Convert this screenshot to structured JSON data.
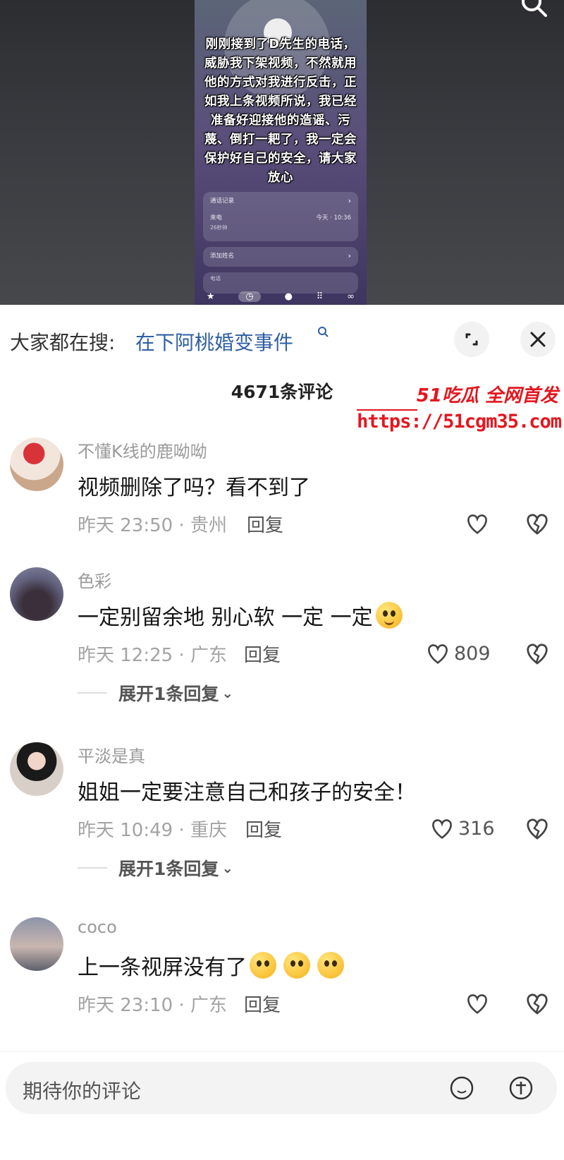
{
  "video": {
    "caption": "刚刚接到了D先生的电话，威胁我下架视频，不然就用他的方式对我进行反击，正如我上条视频所说，我已经准备好迎接他的造谣、污蔑、倒打一耙了，我一定会保护好自己的安全，请大家放心",
    "call_records_label": "通话记录",
    "incoming_label": "来电",
    "duration": "26秒钟",
    "call_time": "今天 · 10:36",
    "add_name_label": "添加姓名",
    "phone_label": "电话"
  },
  "trend": {
    "label": "大家都在搜:",
    "link": "在下阿桃婚变事件"
  },
  "comments_count": "4671条评论",
  "watermark": {
    "brand": "51吃瓜 全网首发",
    "url": "https://51cgm35.com"
  },
  "comments": [
    {
      "user": "不懂K线的鹿呦呦",
      "text": "视频删除了吗？看不到了",
      "time_loc": "昨天 23:50 · 贵州",
      "reply": "回复",
      "likes": ""
    },
    {
      "user": "色彩",
      "text": "一定别留余地 别心软 一定 一定",
      "time_loc": "昨天 12:25 · 广东",
      "reply": "回复",
      "likes": "809",
      "expand": "展开1条回复"
    },
    {
      "user": "平淡是真",
      "text": "姐姐一定要注意自己和孩子的安全！",
      "time_loc": "昨天 10:49 · 重庆",
      "reply": "回复",
      "likes": "316",
      "expand": "展开1条回复"
    },
    {
      "user": "coco",
      "text": "上一条视屏没有了",
      "time_loc": "昨天 23:10 · 广东",
      "reply": "回复",
      "likes": ""
    }
  ],
  "input": {
    "placeholder": "期待你的评论"
  },
  "icons": {
    "search": "search-icon",
    "expand": "fullscreen-icon",
    "close": "close-icon",
    "like": "heart-icon",
    "dislike": "broken-heart-icon",
    "emoji": "emoji-icon",
    "gift": "gift-icon"
  }
}
